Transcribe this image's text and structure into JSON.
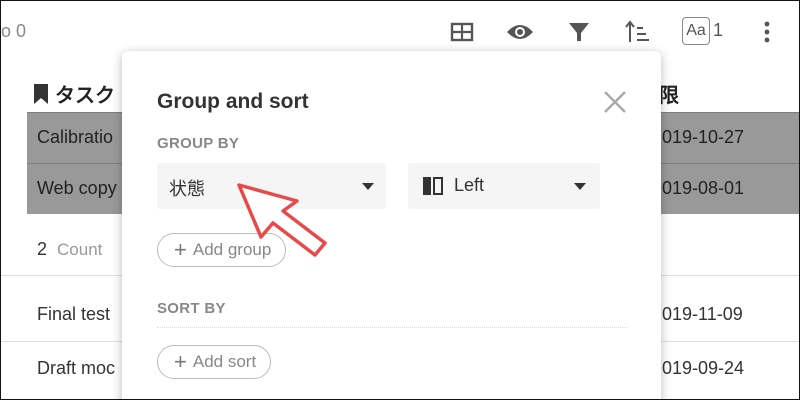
{
  "toolbar": {
    "left_text": "o 0",
    "text_size_label": "Aa",
    "text_size_value": "1",
    "icons": [
      "table-icon",
      "eye-icon",
      "filter-icon",
      "sort-icon",
      "text-size-icon",
      "more-vert-icon"
    ]
  },
  "table": {
    "col1_header": "タスク",
    "col2_header": "限",
    "group1_rows": [
      {
        "name": "Calibratio",
        "date": "019-10-27",
        "selected": true
      },
      {
        "name": "Web copy",
        "date": "019-08-01",
        "selected": true
      }
    ],
    "count_value": "2",
    "count_label": "Count",
    "group2_rows": [
      {
        "name": "Final test",
        "date": "019-11-09"
      },
      {
        "name": "Draft moc",
        "date": "019-09-24"
      }
    ]
  },
  "dialog": {
    "title": "Group and sort",
    "group_by_label": "GROUP BY",
    "group_field_value": "状態",
    "group_position_value": "Left",
    "add_group_label": "Add group",
    "sort_by_label": "SORT BY",
    "add_sort_label": "Add sort"
  },
  "colors": {
    "selected_row": "#999999",
    "cursor_fill": "#ffffff",
    "cursor_stroke": "#e84a4a"
  }
}
